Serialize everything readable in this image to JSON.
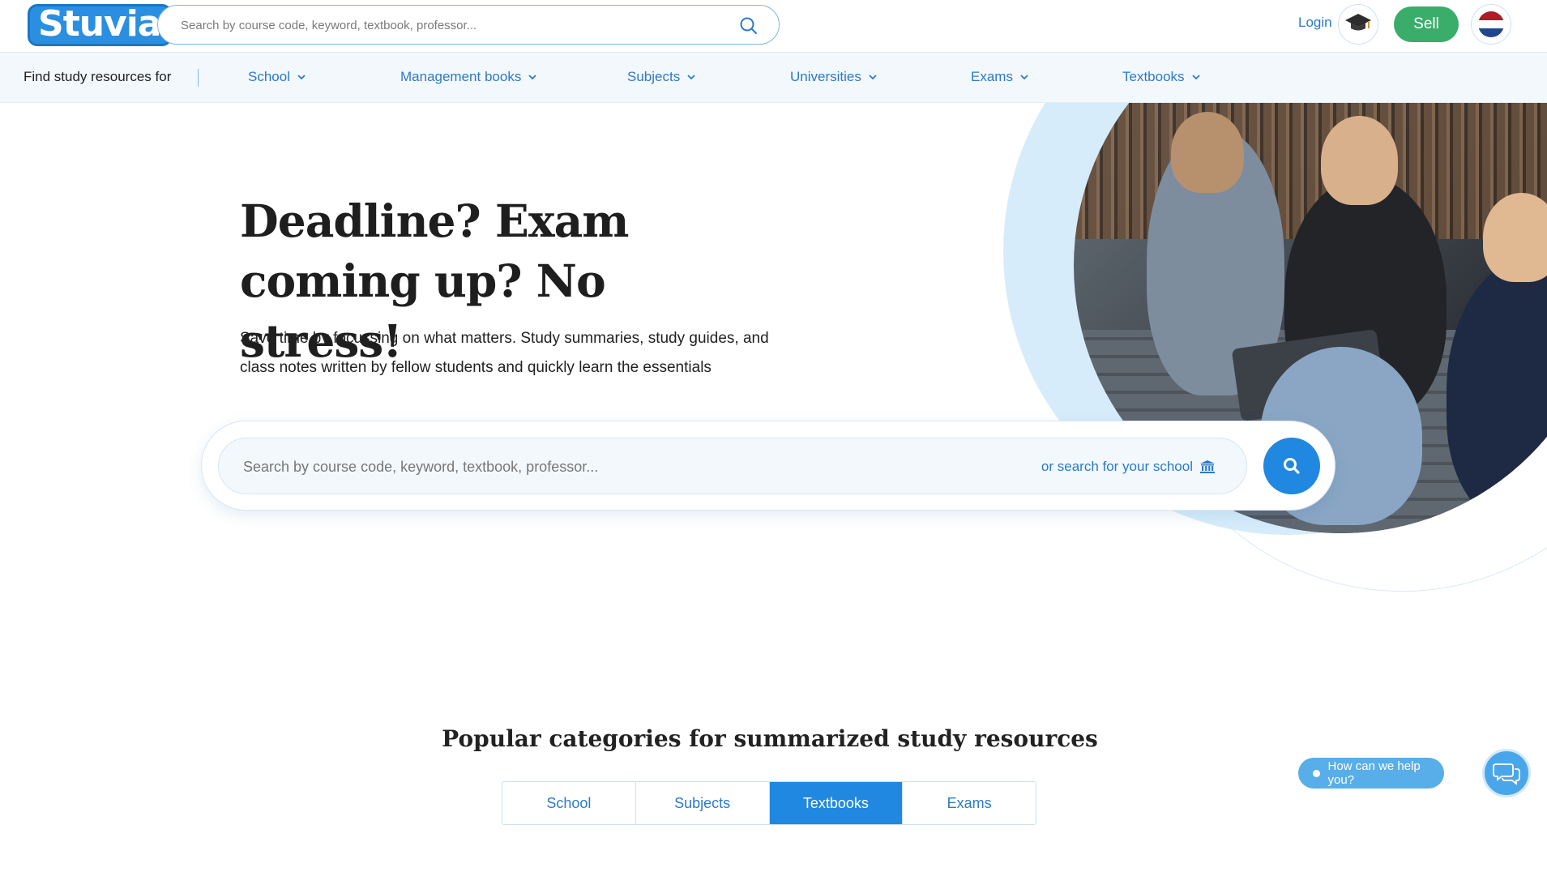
{
  "header": {
    "logo_text": "Stuvia",
    "search_placeholder": "Search by course code, keyword, textbook, professor...",
    "login_label": "Login",
    "sell_label": "Sell",
    "flag_colors": [
      "#ae1c28",
      "#ffffff",
      "#21468b"
    ]
  },
  "subnav": {
    "label": "Find study resources for",
    "items": [
      {
        "label": "School"
      },
      {
        "label": "Management books"
      },
      {
        "label": "Subjects"
      },
      {
        "label": "Universities"
      },
      {
        "label": "Exams"
      },
      {
        "label": "Textbooks"
      }
    ]
  },
  "hero": {
    "title": "Deadline? Exam coming up? No stress!",
    "subtitle": "Save time by focussing on what matters. Study summaries, study guides, and class notes written by fellow students and quickly learn the essentials",
    "search_placeholder": "Search by course code, keyword, textbook, professor...",
    "school_link": "or search for your school"
  },
  "categories": {
    "title": "Popular categories for summarized study resources",
    "tabs": [
      {
        "label": "School",
        "active": false
      },
      {
        "label": "Subjects",
        "active": false
      },
      {
        "label": "Textbooks",
        "active": true
      },
      {
        "label": "Exams",
        "active": false
      }
    ]
  },
  "help": {
    "label": "How can we help you?"
  },
  "colors": {
    "brand_blue": "#2088e0",
    "link_blue": "#2a7bc8",
    "sell_green": "#3aad6b"
  }
}
